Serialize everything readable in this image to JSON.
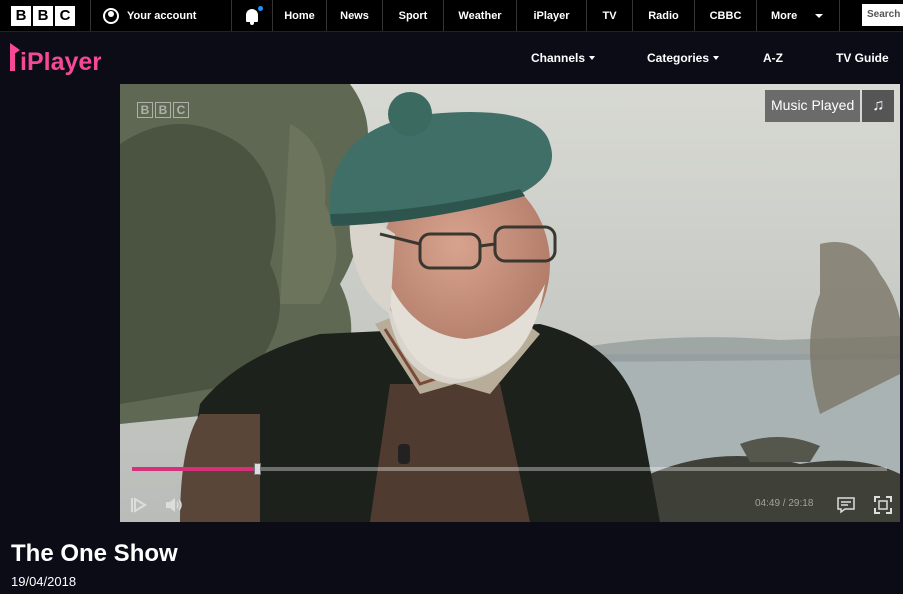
{
  "bbc_nav": {
    "logo_letters": [
      "B",
      "B",
      "C"
    ],
    "account_label": "Your account",
    "links": [
      {
        "label": "Home",
        "width": 0
      },
      {
        "label": "News"
      },
      {
        "label": "Sport"
      },
      {
        "label": "Weather"
      },
      {
        "label": "iPlayer"
      },
      {
        "label": "TV"
      },
      {
        "label": "Radio"
      },
      {
        "label": "CBBC"
      }
    ],
    "more_label": "More",
    "search_placeholder": "Search"
  },
  "iplayer_nav": {
    "logo_text": "iPlayer",
    "channels_label": "Channels",
    "categories_label": "Categories",
    "az_label": "A-Z",
    "tv_guide_label": "TV Guide"
  },
  "player": {
    "watermark_letters": [
      "B",
      "B",
      "C"
    ],
    "music_played_label": "Music Played",
    "progress_fraction": 0.165,
    "elapsed": "04:49",
    "duration": "29:18",
    "time_separator": " / "
  },
  "programme": {
    "title": "The One Show",
    "date": "19/04/2018"
  },
  "colors": {
    "accent_pink": "#d6307b",
    "background": "#0c0c17"
  }
}
